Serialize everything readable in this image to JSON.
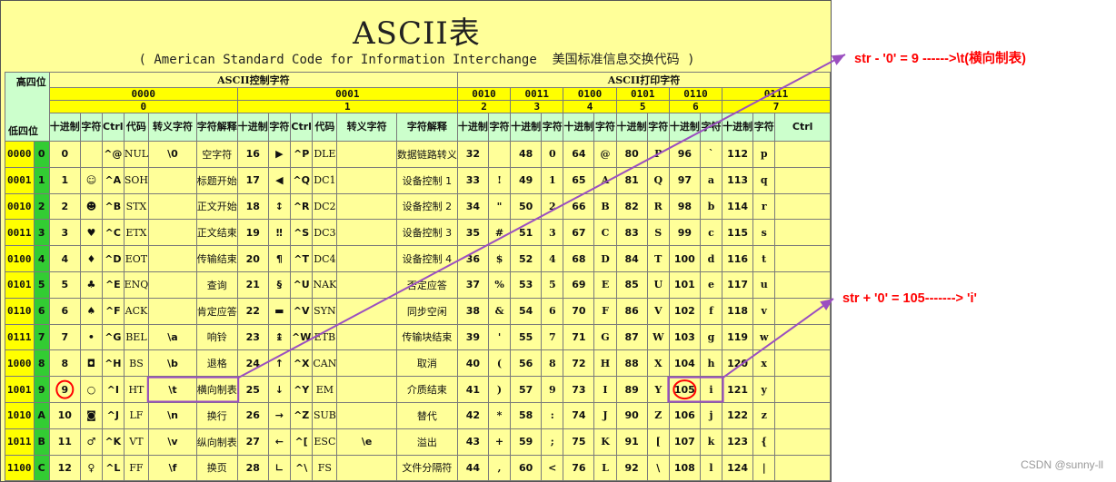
{
  "title": "ASCII表",
  "subtitle": "( American Standard Code for Information Interchange  美国标准信息交换代码 )",
  "header": {
    "corner_top": "高四位",
    "corner_bottom": "低四位",
    "control_group": "ASCII控制字符",
    "printable_group": "ASCII打印字符",
    "high_bins": [
      "0000",
      "0001",
      "0010",
      "0011",
      "0100",
      "0101",
      "0110",
      "0111"
    ],
    "high_hex": [
      "0",
      "1",
      "2",
      "3",
      "4",
      "5",
      "6",
      "7"
    ],
    "col_dec": "十进制",
    "col_char": "字符",
    "col_ctrl": "Ctrl",
    "col_code": "代码",
    "col_escape": "转义字符",
    "col_desc": "字符解释"
  },
  "rows": [
    {
      "bin": "0000",
      "hex": "0",
      "c0": {
        "dec": "0",
        "char": "",
        "ctrl": "^@",
        "code": "NUL",
        "esc": "\\0",
        "desc": "空字符"
      },
      "c1": {
        "dec": "16",
        "char": "▶",
        "ctrl": "^P",
        "code": "DLE",
        "esc": "",
        "desc": "数据链路转义"
      },
      "p": [
        {
          "dec": "32",
          "char": ""
        },
        {
          "dec": "48",
          "char": "0"
        },
        {
          "dec": "64",
          "char": "@"
        },
        {
          "dec": "80",
          "char": "P"
        },
        {
          "dec": "96",
          "char": "`"
        },
        {
          "dec": "112",
          "char": "p"
        }
      ]
    },
    {
      "bin": "0001",
      "hex": "1",
      "c0": {
        "dec": "1",
        "char": "☺",
        "ctrl": "^A",
        "code": "SOH",
        "esc": "",
        "desc": "标题开始"
      },
      "c1": {
        "dec": "17",
        "char": "◀",
        "ctrl": "^Q",
        "code": "DC1",
        "esc": "",
        "desc": "设备控制 1"
      },
      "p": [
        {
          "dec": "33",
          "char": "!"
        },
        {
          "dec": "49",
          "char": "1"
        },
        {
          "dec": "65",
          "char": "A"
        },
        {
          "dec": "81",
          "char": "Q"
        },
        {
          "dec": "97",
          "char": "a"
        },
        {
          "dec": "113",
          "char": "q"
        }
      ]
    },
    {
      "bin": "0010",
      "hex": "2",
      "c0": {
        "dec": "2",
        "char": "☻",
        "ctrl": "^B",
        "code": "STX",
        "esc": "",
        "desc": "正文开始"
      },
      "c1": {
        "dec": "18",
        "char": "↕",
        "ctrl": "^R",
        "code": "DC2",
        "esc": "",
        "desc": "设备控制 2"
      },
      "p": [
        {
          "dec": "34",
          "char": "\""
        },
        {
          "dec": "50",
          "char": "2"
        },
        {
          "dec": "66",
          "char": "B"
        },
        {
          "dec": "82",
          "char": "R"
        },
        {
          "dec": "98",
          "char": "b"
        },
        {
          "dec": "114",
          "char": "r"
        }
      ]
    },
    {
      "bin": "0011",
      "hex": "3",
      "c0": {
        "dec": "3",
        "char": "♥",
        "ctrl": "^C",
        "code": "ETX",
        "esc": "",
        "desc": "正文结束"
      },
      "c1": {
        "dec": "19",
        "char": "‼",
        "ctrl": "^S",
        "code": "DC3",
        "esc": "",
        "desc": "设备控制 3"
      },
      "p": [
        {
          "dec": "35",
          "char": "#"
        },
        {
          "dec": "51",
          "char": "3"
        },
        {
          "dec": "67",
          "char": "C"
        },
        {
          "dec": "83",
          "char": "S"
        },
        {
          "dec": "99",
          "char": "c"
        },
        {
          "dec": "115",
          "char": "s"
        }
      ]
    },
    {
      "bin": "0100",
      "hex": "4",
      "c0": {
        "dec": "4",
        "char": "♦",
        "ctrl": "^D",
        "code": "EOT",
        "esc": "",
        "desc": "传输结束"
      },
      "c1": {
        "dec": "20",
        "char": "¶",
        "ctrl": "^T",
        "code": "DC4",
        "esc": "",
        "desc": "设备控制 4"
      },
      "p": [
        {
          "dec": "36",
          "char": "$"
        },
        {
          "dec": "52",
          "char": "4"
        },
        {
          "dec": "68",
          "char": "D"
        },
        {
          "dec": "84",
          "char": "T"
        },
        {
          "dec": "100",
          "char": "d"
        },
        {
          "dec": "116",
          "char": "t"
        }
      ]
    },
    {
      "bin": "0101",
      "hex": "5",
      "c0": {
        "dec": "5",
        "char": "♣",
        "ctrl": "^E",
        "code": "ENQ",
        "esc": "",
        "desc": "查询"
      },
      "c1": {
        "dec": "21",
        "char": "§",
        "ctrl": "^U",
        "code": "NAK",
        "esc": "",
        "desc": "否定应答"
      },
      "p": [
        {
          "dec": "37",
          "char": "%"
        },
        {
          "dec": "53",
          "char": "5"
        },
        {
          "dec": "69",
          "char": "E"
        },
        {
          "dec": "85",
          "char": "U"
        },
        {
          "dec": "101",
          "char": "e"
        },
        {
          "dec": "117",
          "char": "u"
        }
      ]
    },
    {
      "bin": "0110",
      "hex": "6",
      "c0": {
        "dec": "6",
        "char": "♠",
        "ctrl": "^F",
        "code": "ACK",
        "esc": "",
        "desc": "肯定应答"
      },
      "c1": {
        "dec": "22",
        "char": "▬",
        "ctrl": "^V",
        "code": "SYN",
        "esc": "",
        "desc": "同步空闲"
      },
      "p": [
        {
          "dec": "38",
          "char": "&"
        },
        {
          "dec": "54",
          "char": "6"
        },
        {
          "dec": "70",
          "char": "F"
        },
        {
          "dec": "86",
          "char": "V"
        },
        {
          "dec": "102",
          "char": "f"
        },
        {
          "dec": "118",
          "char": "v"
        }
      ]
    },
    {
      "bin": "0111",
      "hex": "7",
      "c0": {
        "dec": "7",
        "char": "•",
        "ctrl": "^G",
        "code": "BEL",
        "esc": "\\a",
        "desc": "响铃"
      },
      "c1": {
        "dec": "23",
        "char": "↨",
        "ctrl": "^W",
        "code": "ETB",
        "esc": "",
        "desc": "传输块结束"
      },
      "p": [
        {
          "dec": "39",
          "char": "'"
        },
        {
          "dec": "55",
          "char": "7"
        },
        {
          "dec": "71",
          "char": "G"
        },
        {
          "dec": "87",
          "char": "W"
        },
        {
          "dec": "103",
          "char": "g"
        },
        {
          "dec": "119",
          "char": "w"
        }
      ]
    },
    {
      "bin": "1000",
      "hex": "8",
      "c0": {
        "dec": "8",
        "char": "◘",
        "ctrl": "^H",
        "code": "BS",
        "esc": "\\b",
        "desc": "退格"
      },
      "c1": {
        "dec": "24",
        "char": "↑",
        "ctrl": "^X",
        "code": "CAN",
        "esc": "",
        "desc": "取消"
      },
      "p": [
        {
          "dec": "40",
          "char": "("
        },
        {
          "dec": "56",
          "char": "8"
        },
        {
          "dec": "72",
          "char": "H"
        },
        {
          "dec": "88",
          "char": "X"
        },
        {
          "dec": "104",
          "char": "h"
        },
        {
          "dec": "120",
          "char": "x"
        }
      ]
    },
    {
      "bin": "1001",
      "hex": "9",
      "c0": {
        "dec": "9",
        "char": "○",
        "ctrl": "^I",
        "code": "HT",
        "esc": "\\t",
        "desc": "横向制表"
      },
      "c1": {
        "dec": "25",
        "char": "↓",
        "ctrl": "^Y",
        "code": "EM",
        "esc": "",
        "desc": "介质结束"
      },
      "p": [
        {
          "dec": "41",
          "char": ")"
        },
        {
          "dec": "57",
          "char": "9"
        },
        {
          "dec": "73",
          "char": "I"
        },
        {
          "dec": "89",
          "char": "Y"
        },
        {
          "dec": "105",
          "char": "i"
        },
        {
          "dec": "121",
          "char": "y"
        }
      ]
    },
    {
      "bin": "1010",
      "hex": "A",
      "c0": {
        "dec": "10",
        "char": "◙",
        "ctrl": "^J",
        "code": "LF",
        "esc": "\\n",
        "desc": "换行"
      },
      "c1": {
        "dec": "26",
        "char": "→",
        "ctrl": "^Z",
        "code": "SUB",
        "esc": "",
        "desc": "替代"
      },
      "p": [
        {
          "dec": "42",
          "char": "*"
        },
        {
          "dec": "58",
          "char": ":"
        },
        {
          "dec": "74",
          "char": "J"
        },
        {
          "dec": "90",
          "char": "Z"
        },
        {
          "dec": "106",
          "char": "j"
        },
        {
          "dec": "122",
          "char": "z"
        }
      ]
    },
    {
      "bin": "1011",
      "hex": "B",
      "c0": {
        "dec": "11",
        "char": "♂",
        "ctrl": "^K",
        "code": "VT",
        "esc": "\\v",
        "desc": "纵向制表"
      },
      "c1": {
        "dec": "27",
        "char": "←",
        "ctrl": "^[",
        "code": "ESC",
        "esc": "\\e",
        "desc": "溢出"
      },
      "p": [
        {
          "dec": "43",
          "char": "+"
        },
        {
          "dec": "59",
          "char": ";"
        },
        {
          "dec": "75",
          "char": "K"
        },
        {
          "dec": "91",
          "char": "["
        },
        {
          "dec": "107",
          "char": "k"
        },
        {
          "dec": "123",
          "char": "{"
        }
      ]
    },
    {
      "bin": "1100",
      "hex": "C",
      "c0": {
        "dec": "12",
        "char": "♀",
        "ctrl": "^L",
        "code": "FF",
        "esc": "\\f",
        "desc": "换页"
      },
      "c1": {
        "dec": "28",
        "char": "∟",
        "ctrl": "^\\",
        "code": "FS",
        "esc": "",
        "desc": "文件分隔符"
      },
      "p": [
        {
          "dec": "44",
          "char": ","
        },
        {
          "dec": "60",
          "char": "<"
        },
        {
          "dec": "76",
          "char": "L"
        },
        {
          "dec": "92",
          "char": "\\"
        },
        {
          "dec": "108",
          "char": "l"
        },
        {
          "dec": "124",
          "char": "|"
        }
      ]
    }
  ],
  "annotations": {
    "top": "str - '0' = 9 ------>\\t(横向制表)",
    "bottom": "str + '0' = 105-------> 'i'",
    "color": "#ff0000",
    "arrow_color": "#9b4fc0"
  },
  "watermark": "CSDN @sunny-ll"
}
